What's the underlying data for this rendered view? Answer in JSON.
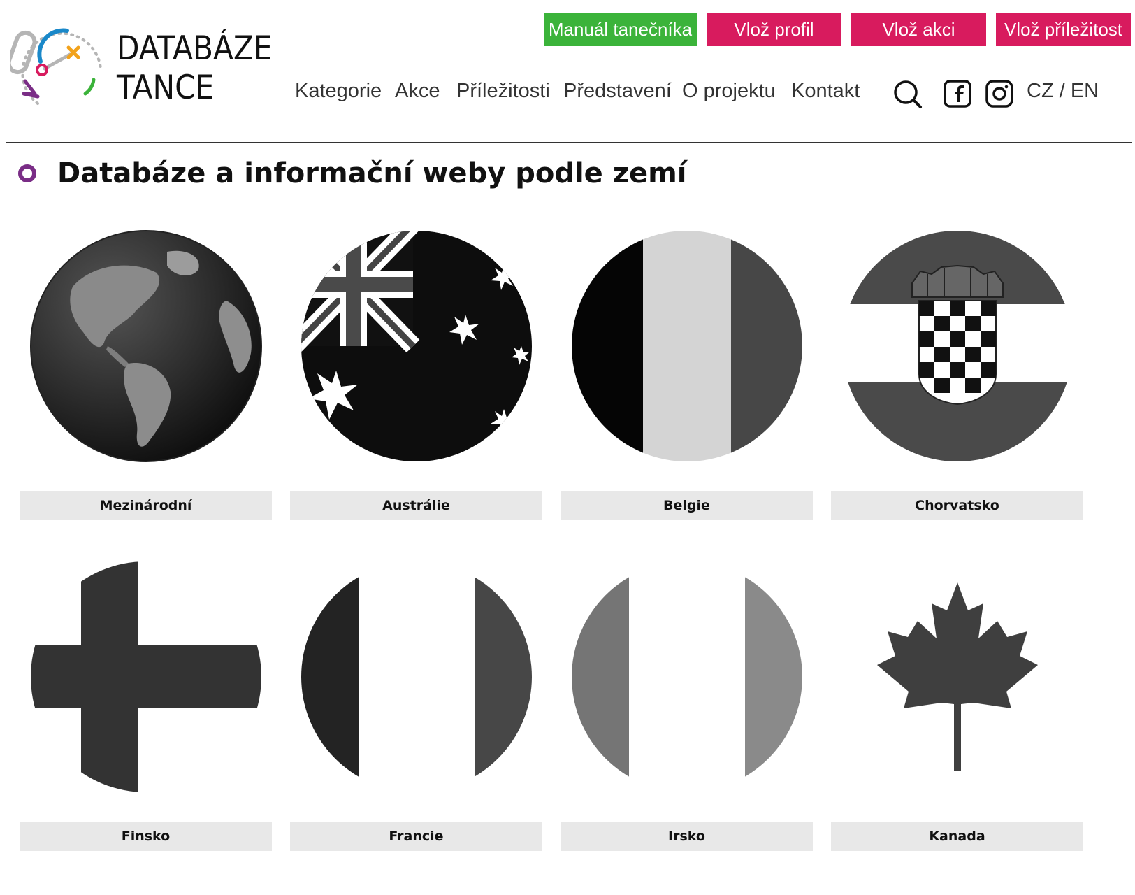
{
  "logo": {
    "line1": "DATABÁZE",
    "line2": "TANCE",
    "colors": {
      "purple": "#7a2d86",
      "blue": "#1a88c9",
      "orange": "#f2a21b",
      "green": "#3bb33a",
      "red": "#d81b5e",
      "gray": "#b5b5b5"
    }
  },
  "top_buttons": [
    {
      "label": "Manuál tanečníka",
      "color": "#3bb33a"
    },
    {
      "label": "Vlož profil",
      "color": "#d81b5e"
    },
    {
      "label": "Vlož akci",
      "color": "#d81b5e"
    },
    {
      "label": "Vlož příležitost",
      "color": "#d81b5e"
    }
  ],
  "nav": {
    "items": [
      "Kategorie",
      "Akce",
      "Příležitosti",
      "Představení",
      "O projektu",
      "Kontakt"
    ],
    "icons": [
      "search-icon",
      "facebook-icon",
      "instagram-icon"
    ],
    "lang": "CZ / EN"
  },
  "page": {
    "title": "Databáze a informační weby podle zemí",
    "bullet_color": "#7a2d86"
  },
  "countries": [
    {
      "label": "Mezinárodní",
      "flag": "globe"
    },
    {
      "label": "Austrálie",
      "flag": "australia"
    },
    {
      "label": "Belgie",
      "flag": "belgium"
    },
    {
      "label": "Chorvatsko",
      "flag": "croatia"
    },
    {
      "label": "Finsko",
      "flag": "finland"
    },
    {
      "label": "Francie",
      "flag": "france"
    },
    {
      "label": "Irsko",
      "flag": "ireland"
    },
    {
      "label": "Kanada",
      "flag": "canada"
    }
  ]
}
